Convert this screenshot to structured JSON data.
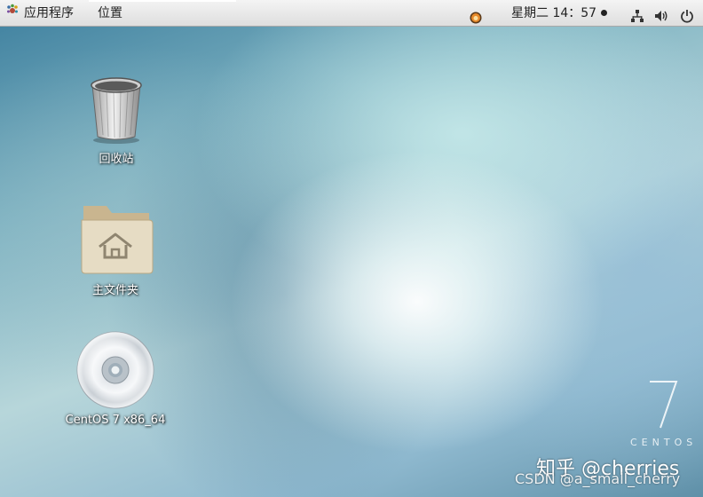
{
  "top_panel": {
    "applications_label": "应用程序",
    "places_label": "位置",
    "clock_text": "星期二 14：57"
  },
  "desktop": {
    "icons": [
      {
        "label": "回收站",
        "icon": "trash-icon"
      },
      {
        "label": "主文件夹",
        "icon": "home-folder-icon"
      },
      {
        "label": "CentOS 7 x86_64",
        "icon": "optical-disc-icon"
      }
    ]
  },
  "branding": {
    "version_numeral": "7",
    "brand_word": "CENTOS"
  },
  "watermarks": {
    "zhihu": "知乎 @cherries",
    "csdn": "CSDN @a_small_cherry"
  },
  "colors": {
    "panel_bg": "#dedede",
    "label_text": "#ffffff"
  }
}
